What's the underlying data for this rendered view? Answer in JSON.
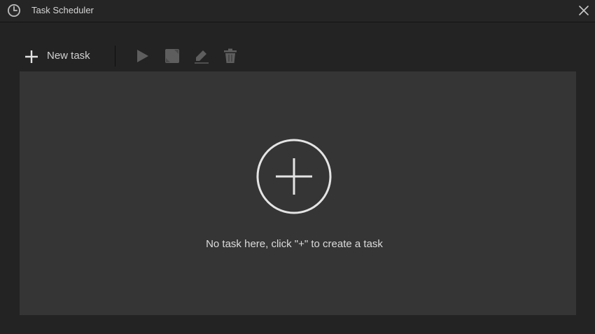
{
  "window": {
    "title": "Task Scheduler",
    "app_icon": "clock-icon",
    "close_icon": "close-icon"
  },
  "toolbar": {
    "new_task_label": "New task",
    "new_task_icon": "plus-icon",
    "run_icon": "play-icon",
    "stop_icon": "stop-icon",
    "edit_icon": "pencil-icon",
    "delete_icon": "trash-icon"
  },
  "content": {
    "add_icon": "plus-circle-icon",
    "empty_message": "No task here, click \"+\" to create a task"
  },
  "colors": {
    "window_bg": "#232323",
    "panel_bg": "#353535",
    "text": "#dcdcdc",
    "disabled_icon": "#5e5e5e"
  }
}
